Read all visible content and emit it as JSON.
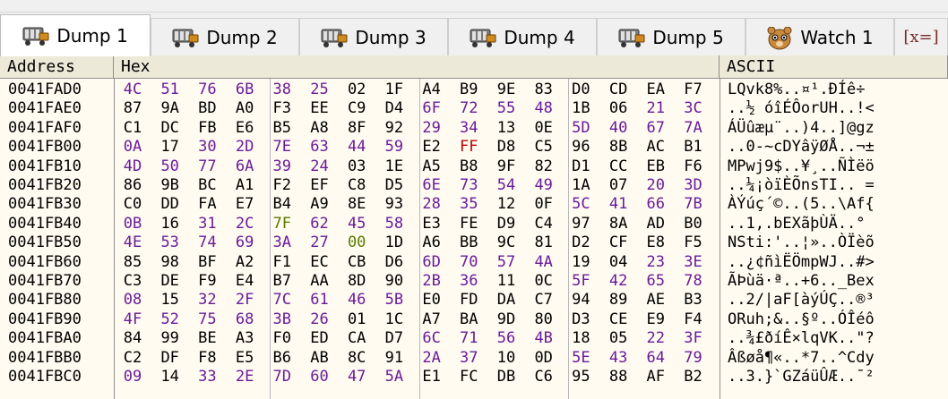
{
  "tabs": [
    {
      "label": "Dump 1",
      "icon": "memory-dump-icon",
      "active": true
    },
    {
      "label": "Dump 2",
      "icon": "memory-dump-icon",
      "active": false
    },
    {
      "label": "Dump 3",
      "icon": "memory-dump-icon",
      "active": false
    },
    {
      "label": "Dump 4",
      "icon": "memory-dump-icon",
      "active": false
    },
    {
      "label": "Dump 5",
      "icon": "memory-dump-icon",
      "active": false
    },
    {
      "label": "Watch 1",
      "icon": "watch-icon",
      "active": false
    },
    {
      "label": "[x=]",
      "icon": "locals-icon",
      "active": false
    }
  ],
  "columns": {
    "address": "Address",
    "hex": "Hex",
    "ascii": "ASCII"
  },
  "colors": {
    "string_byte": "#6a1b9a",
    "green_byte": "#5a7a00",
    "red_byte": "#b80000",
    "background": "#fffbf0",
    "header_bg": "#ece9d8"
  },
  "rows": [
    {
      "addr": "0041FAD0",
      "hex": [
        "4C",
        "51",
        "76",
        "6B",
        "38",
        "25",
        "02",
        "1F",
        "A4",
        "B9",
        "9E",
        "83",
        "D0",
        "CD",
        "EA",
        "F7"
      ],
      "ascii": "LQvk8%..¤¹.ÐÍê÷"
    },
    {
      "addr": "0041FAE0",
      "hex": [
        "87",
        "9A",
        "BD",
        "A0",
        "F3",
        "EE",
        "C9",
        "D4",
        "6F",
        "72",
        "55",
        "48",
        "1B",
        "06",
        "21",
        "3C"
      ],
      "ascii": "..½ óîÉÔorUH..!<"
    },
    {
      "addr": "0041FAF0",
      "hex": [
        "C1",
        "DC",
        "FB",
        "E6",
        "B5",
        "A8",
        "8F",
        "92",
        "29",
        "34",
        "13",
        "0E",
        "5D",
        "40",
        "67",
        "7A"
      ],
      "ascii": "ÁÜûæµ¨..)4..]@gz"
    },
    {
      "addr": "0041FB00",
      "hex": [
        "0A",
        "17",
        "30",
        "2D",
        "7E",
        "63",
        "44",
        "59",
        "E2",
        "FF",
        "D8",
        "C5",
        "96",
        "8B",
        "AC",
        "B1"
      ],
      "ascii": "..0-~cDYâÿØÅ..¬±"
    },
    {
      "addr": "0041FB10",
      "hex": [
        "4D",
        "50",
        "77",
        "6A",
        "39",
        "24",
        "03",
        "1E",
        "A5",
        "B8",
        "9F",
        "82",
        "D1",
        "CC",
        "EB",
        "F6"
      ],
      "ascii": "MPwj9$..¥¸..ÑÌëö"
    },
    {
      "addr": "0041FB20",
      "hex": [
        "86",
        "9B",
        "BC",
        "A1",
        "F2",
        "EF",
        "C8",
        "D5",
        "6E",
        "73",
        "54",
        "49",
        "1A",
        "07",
        "20",
        "3D"
      ],
      "ascii": "..¼¡òïÈÕnsTI.. ="
    },
    {
      "addr": "0041FB30",
      "hex": [
        "C0",
        "DD",
        "FA",
        "E7",
        "B4",
        "A9",
        "8E",
        "93",
        "28",
        "35",
        "12",
        "0F",
        "5C",
        "41",
        "66",
        "7B"
      ],
      "ascii": "ÀÝúç´©..(5..\\Af{"
    },
    {
      "addr": "0041FB40",
      "hex": [
        "0B",
        "16",
        "31",
        "2C",
        "7F",
        "62",
        "45",
        "58",
        "E3",
        "FE",
        "D9",
        "C4",
        "97",
        "8A",
        "AD",
        "B0"
      ],
      "ascii": "..1,.bEXãþÙÄ..­°"
    },
    {
      "addr": "0041FB50",
      "hex": [
        "4E",
        "53",
        "74",
        "69",
        "3A",
        "27",
        "00",
        "1D",
        "A6",
        "BB",
        "9C",
        "81",
        "D2",
        "CF",
        "E8",
        "F5"
      ],
      "ascii": "NSti:'..¦»..ÒÏèõ"
    },
    {
      "addr": "0041FB60",
      "hex": [
        "85",
        "98",
        "BF",
        "A2",
        "F1",
        "EC",
        "CB",
        "D6",
        "6D",
        "70",
        "57",
        "4A",
        "19",
        "04",
        "23",
        "3E"
      ],
      "ascii": "..¿¢ñìËÖmpWJ..#>"
    },
    {
      "addr": "0041FB70",
      "hex": [
        "C3",
        "DE",
        "F9",
        "E4",
        "B7",
        "AA",
        "8D",
        "90",
        "2B",
        "36",
        "11",
        "0C",
        "5F",
        "42",
        "65",
        "78"
      ],
      "ascii": "ÃÞùä·ª..+6.._Bex"
    },
    {
      "addr": "0041FB80",
      "hex": [
        "08",
        "15",
        "32",
        "2F",
        "7C",
        "61",
        "46",
        "5B",
        "E0",
        "FD",
        "DA",
        "C7",
        "94",
        "89",
        "AE",
        "B3"
      ],
      "ascii": "..2/|aF[àýÚÇ..®³"
    },
    {
      "addr": "0041FB90",
      "hex": [
        "4F",
        "52",
        "75",
        "68",
        "3B",
        "26",
        "01",
        "1C",
        "A7",
        "BA",
        "9D",
        "80",
        "D3",
        "CE",
        "E9",
        "F4"
      ],
      "ascii": "ORuh;&..§º..ÓÎéô"
    },
    {
      "addr": "0041FBA0",
      "hex": [
        "84",
        "99",
        "BE",
        "A3",
        "F0",
        "ED",
        "CA",
        "D7",
        "6C",
        "71",
        "56",
        "4B",
        "18",
        "05",
        "22",
        "3F"
      ],
      "ascii": "..¾£ðíÊ×lqVK..\"?"
    },
    {
      "addr": "0041FBB0",
      "hex": [
        "C2",
        "DF",
        "F8",
        "E5",
        "B6",
        "AB",
        "8C",
        "91",
        "2A",
        "37",
        "10",
        "0D",
        "5E",
        "43",
        "64",
        "79"
      ],
      "ascii": "Âßøå¶«..*7..^Cdy"
    },
    {
      "addr": "0041FBC0",
      "hex": [
        "09",
        "14",
        "33",
        "2E",
        "7D",
        "60",
        "47",
        "5A",
        "E1",
        "FC",
        "DB",
        "C6",
        "95",
        "88",
        "AF",
        "B2"
      ],
      "ascii": "..3.}`GZáüÛÆ..¯²"
    }
  ]
}
